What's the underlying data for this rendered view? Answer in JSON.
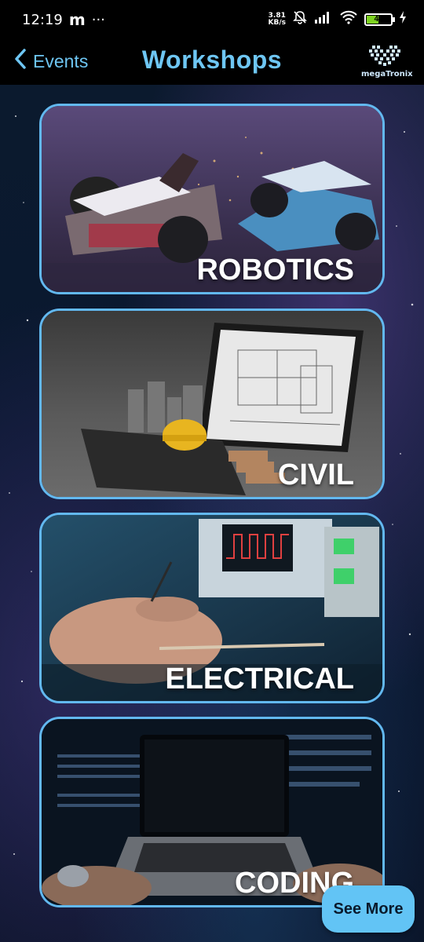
{
  "status_bar": {
    "time": "12:19",
    "app_indicator": "m",
    "more": "···",
    "net_speed_value": "3.81",
    "net_speed_unit": "KB/s",
    "battery_level": "47"
  },
  "header": {
    "back_label": "Events",
    "title": "Workshops",
    "logo_text": "megaTronix"
  },
  "workshops": [
    {
      "label": "ROBOTICS"
    },
    {
      "label": "CIVIL"
    },
    {
      "label": "ELECTRICAL"
    },
    {
      "label": "CODING"
    }
  ],
  "see_more_label": "See More",
  "colors": {
    "accent": "#62b8ef",
    "header_bg": "#000000",
    "button_bg": "#62c4f5"
  },
  "icons": [
    "back-chevron-icon",
    "mute-icon",
    "signal-icon",
    "wifi-icon",
    "battery-icon",
    "charging-icon"
  ]
}
